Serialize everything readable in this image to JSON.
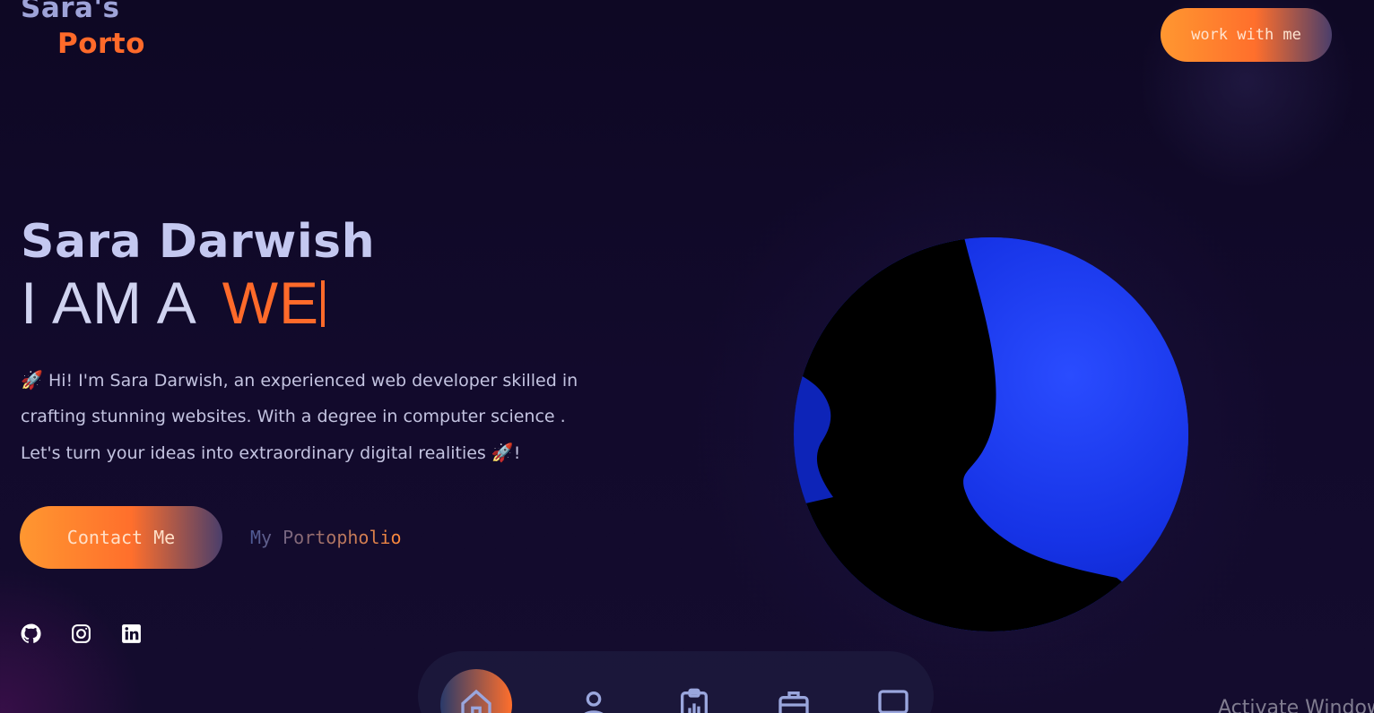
{
  "logo": {
    "line1": "Sara's",
    "line2": "Porto"
  },
  "header": {
    "cta_label": "work with me"
  },
  "hero": {
    "name": "Sara Darwish",
    "role_prefix": "I AM A",
    "role_typed": "WE",
    "bio_emoji": "🚀",
    "bio_text": " Hi! I'm Sara Darwish, an experienced web developer skilled in crafting stunning websites. With a degree in computer science . Let's turn your ideas into extraordinary digital realities ",
    "bio_end_emoji": "🚀",
    "bio_end_punct": "!",
    "contact_label": "Contact Me",
    "portfolio_label": "My Portopholio"
  },
  "socials": [
    {
      "icon": "github-icon"
    },
    {
      "icon": "instagram-icon"
    },
    {
      "icon": "linkedin-icon"
    }
  ],
  "bottom_nav": [
    {
      "icon": "home-icon",
      "active": true
    },
    {
      "icon": "user-icon",
      "active": false
    },
    {
      "icon": "clipboard-chart-icon",
      "active": false
    },
    {
      "icon": "briefcase-icon",
      "active": false
    },
    {
      "icon": "chat-icon",
      "active": false
    }
  ],
  "watermark": "Activate Windows",
  "colors": {
    "accent": "#ff6a2a",
    "background": "#120a2c",
    "portrait_blue": "#1230e0"
  }
}
